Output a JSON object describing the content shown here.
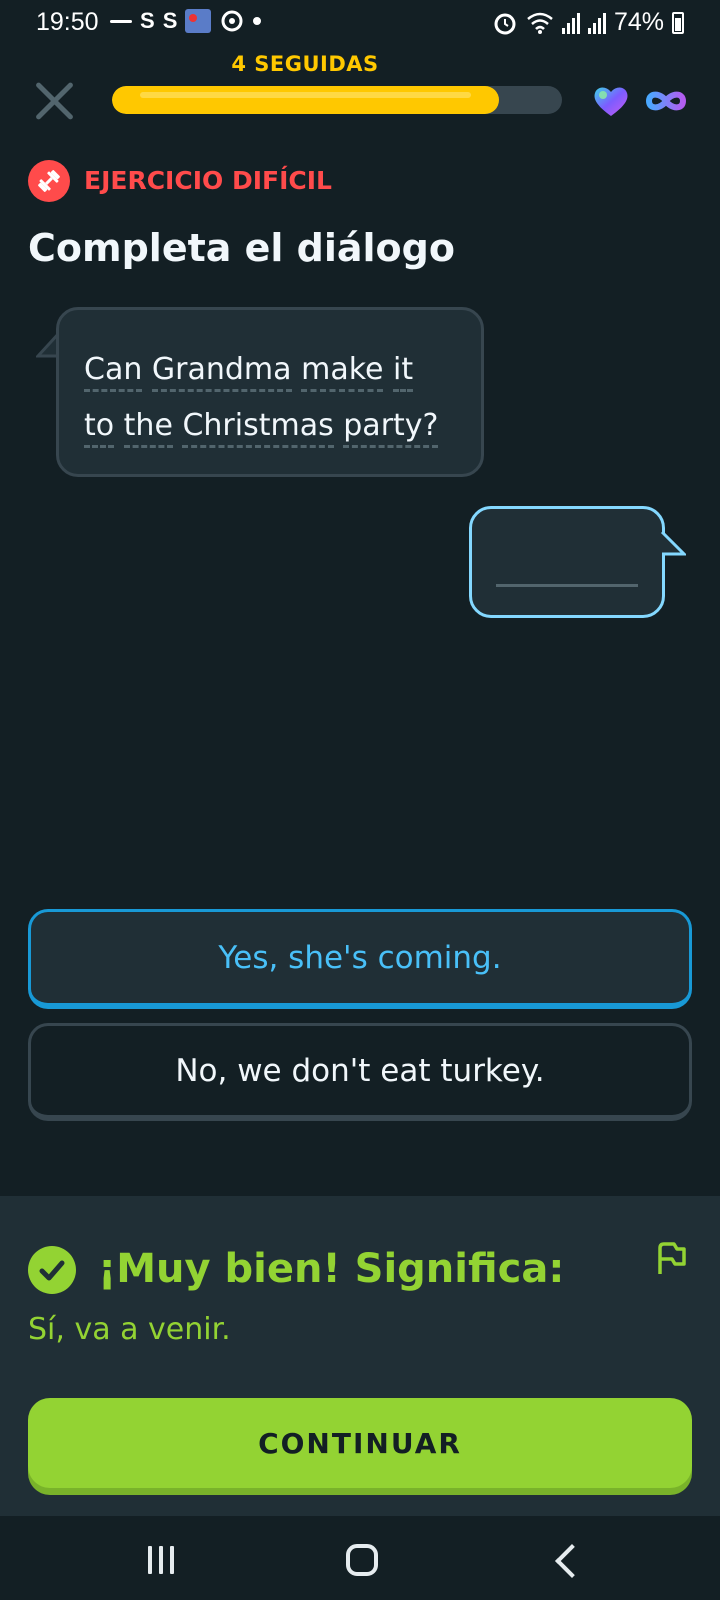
{
  "status_bar": {
    "time": "19:50",
    "app_icons": [
      "S",
      "S"
    ],
    "battery": "74%"
  },
  "header": {
    "streak_label": "4 SEGUIDAS",
    "progress_fraction": 0.86,
    "icons": [
      "close-icon",
      "heart-icon",
      "infinity-icon"
    ]
  },
  "exercise": {
    "tag": "EJERCICIO DIFÍCIL",
    "title": "Completa el diálogo",
    "prompt_words": [
      "Can",
      "Grandma",
      "make",
      "it",
      "to",
      "the",
      "Christmas",
      "party?"
    ]
  },
  "choices": [
    {
      "label": "Yes, she's coming.",
      "selected": true
    },
    {
      "label": "No, we don't eat turkey.",
      "selected": false
    }
  ],
  "feedback": {
    "title": "¡Muy bien! Significa:",
    "meaning": "Sí, va a venir.",
    "continue_label": "CONTINUAR"
  },
  "colors": {
    "background": "#131f24",
    "streak": "#ffc800",
    "hard": "#ff4b4b",
    "selected": "#49c0f8",
    "success": "#93d333"
  }
}
